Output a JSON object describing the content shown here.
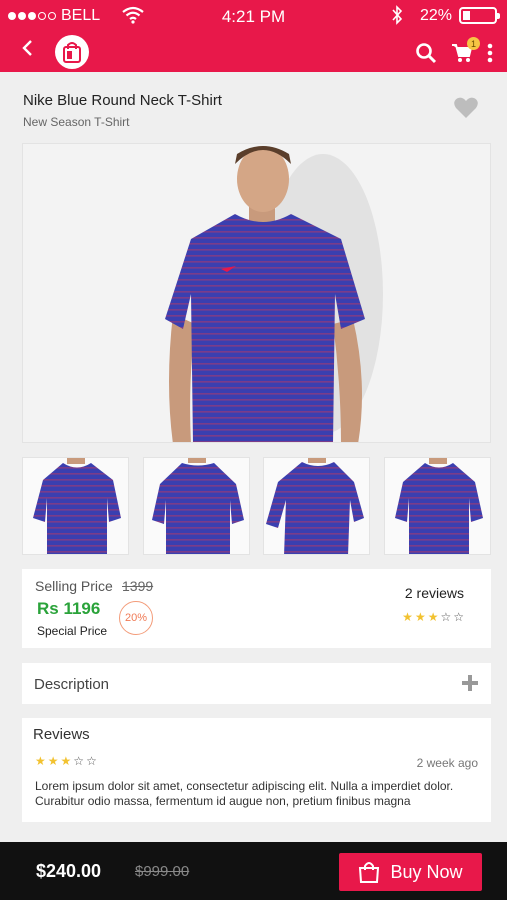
{
  "status_bar": {
    "carrier": "BELL",
    "time": "4:21 PM",
    "battery_pct": "22%",
    "battery_level": 0.22
  },
  "header": {
    "icons": [
      "back-arrow-icon",
      "shopping-bag-logo-icon",
      "search-icon",
      "cart-icon",
      "more-vertical-icon"
    ],
    "cart_badge": "1",
    "brand_color": "#e8184a"
  },
  "product": {
    "title": "Nike Blue Round Neck T-Shirt",
    "subtitle": "New Season T-Shirt"
  },
  "pricing": {
    "selling_label": "Selling Price",
    "original_price": "1399",
    "price": "Rs 1196",
    "special_label": "Special Price",
    "discount": "20%",
    "reviews": "2 reviews",
    "rating": 3,
    "max_rating": 5
  },
  "description": {
    "label": "Description"
  },
  "reviews_section": {
    "title": "Reviews",
    "rating": 3,
    "time": "2 week ago",
    "text": "Lorem ipsum dolor sit amet, consectetur adipiscing elit. Nulla a imperdiet dolor. Curabitur odio massa, fermentum id augue non, pretium finibus magna"
  },
  "bottom_bar": {
    "price": "$240.00",
    "original_price": "$999.00",
    "buy_label": "Buy Now"
  }
}
